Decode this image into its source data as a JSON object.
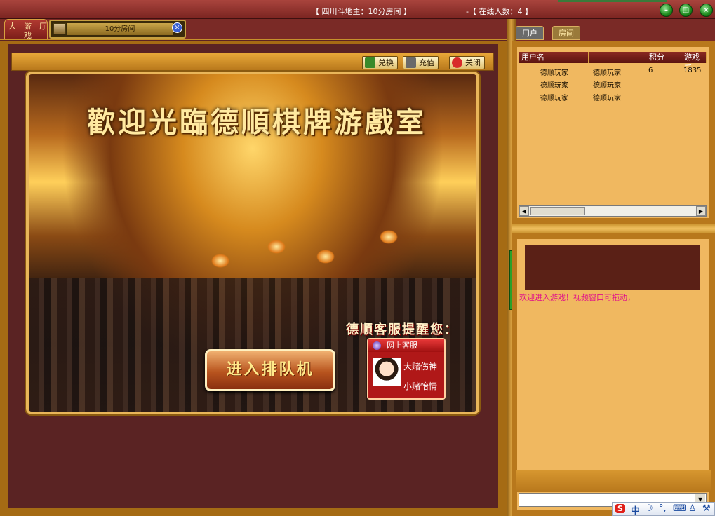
{
  "window": {
    "title_room": "【 四川斗地主：10分房间 】",
    "title_online": "-【 在线人数：4 】",
    "controls": [
      "minimize",
      "maximize",
      "close"
    ],
    "accent": "#a56b14",
    "brand_red": "#7a2a26"
  },
  "tabs": {
    "lobby_chars": [
      "大",
      "游",
      "厅",
      "戏"
    ],
    "room_label": "10分房间"
  },
  "toolbar": {
    "exchange_label": "兑换",
    "recharge_label": "充值",
    "close_label": "关闭"
  },
  "hero": {
    "welcome_title": "歡迎光臨德順棋牌游戲室",
    "reminder": "德順客服提醒您：",
    "queue_button": "进入排队机",
    "cs_title": "网上客服",
    "cs_agents": [
      "大赌伤神",
      "小赌怡情"
    ]
  },
  "right_panel": {
    "tabs": [
      "用户",
      "房间"
    ],
    "columns": [
      "用户名",
      "",
      "积分",
      "游戏币"
    ],
    "users": [
      {
        "name": "德顺玩家",
        "nickname": "德顺玩家",
        "score": "6",
        "coins": "1835"
      },
      {
        "name": "德顺玩家",
        "nickname": "德顺玩家",
        "score": "",
        "coins": ""
      },
      {
        "name": "德顺玩家",
        "nickname": "德顺玩家",
        "score": "",
        "coins": ""
      }
    ],
    "chat_message": "欢迎进入游戏！视频窗口可拖动，",
    "chat_message_color": "#e0108a"
  },
  "ime": {
    "logo": "S",
    "mode": "中",
    "icons": [
      "moon-icon",
      "punctuation-icon",
      "keyboard-icon",
      "user-icon",
      "wrench-icon"
    ]
  }
}
